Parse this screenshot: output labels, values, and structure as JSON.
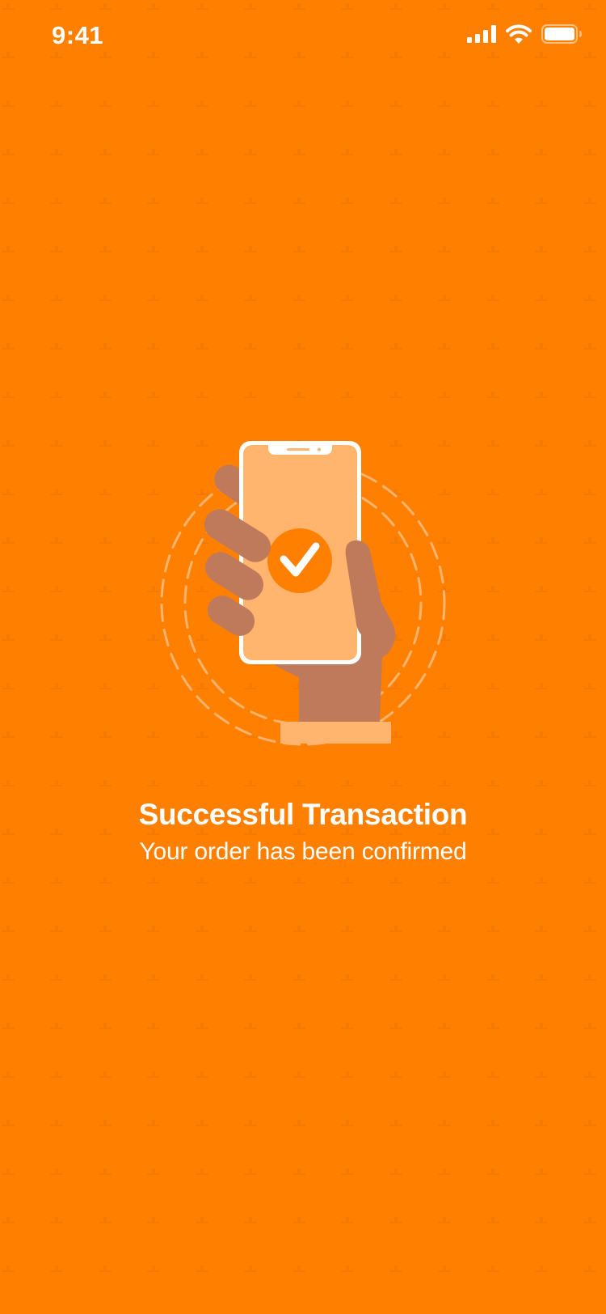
{
  "colors": {
    "background": "#FF7F00",
    "pattern_plus": "#F57A04",
    "phone_screen": "#FFB56D",
    "hand": "#BE7A5B",
    "sleeve": "#FFB56D",
    "check_circle": "#FF7F00",
    "dashed_rings": "#FFB56D"
  },
  "status_bar": {
    "time": "9:41",
    "icons": [
      "cellular-signal-icon",
      "wifi-icon",
      "battery-icon"
    ]
  },
  "illustration": {
    "icon": "hand-holding-phone-checkmark-icon"
  },
  "message": {
    "title": "Successful Transaction",
    "subtitle": "Your order has been confirmed"
  }
}
